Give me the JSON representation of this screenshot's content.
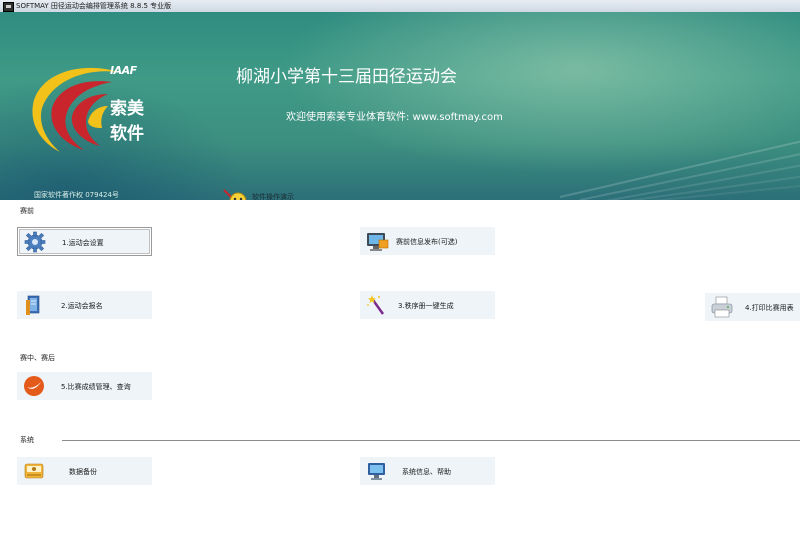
{
  "window": {
    "title": "SOFTMAY 田径运动会编排管理系统 8.8.5  专业版",
    "app_icon": "app-icon"
  },
  "banner": {
    "logo_iaaf": "IAAF",
    "logo_brand_line1": "索美",
    "logo_brand_line2": "软件",
    "event_title": "柳湖小学第十三届田径运动会",
    "welcome": "欢迎使用索美专业体育软件: www.softmay.com",
    "copyright": "国家软件著作权 079424号",
    "demo_link": "软件操作演示",
    "colors": {
      "base": "#3c8f80",
      "light": "#9fd3b6",
      "logo_red": "#c8252c",
      "logo_yellow": "#f2c21b"
    }
  },
  "sections": {
    "pre": "赛前",
    "during": "赛中、赛后",
    "system": "系统"
  },
  "cards": {
    "games_settings": {
      "label": "1.运动会设置",
      "icon": "gear-icon"
    },
    "info_publish": {
      "label": "赛前信息发布(可选)",
      "icon": "monitor-publish-icon"
    },
    "registration": {
      "label": "2.运动会报名",
      "icon": "registration-book-icon"
    },
    "program_generate": {
      "label": "3.秩序册一键生成",
      "icon": "magic-wand-icon"
    },
    "print_forms": {
      "label": "4.打印比赛用表",
      "icon": "printer-icon"
    },
    "results_manage": {
      "label": "5.比赛成绩管理、查询",
      "icon": "results-icon"
    },
    "data_backup": {
      "label": "数据备份",
      "icon": "backup-drive-icon"
    },
    "system_info": {
      "label": "系统信息、帮助",
      "icon": "computer-icon"
    }
  }
}
